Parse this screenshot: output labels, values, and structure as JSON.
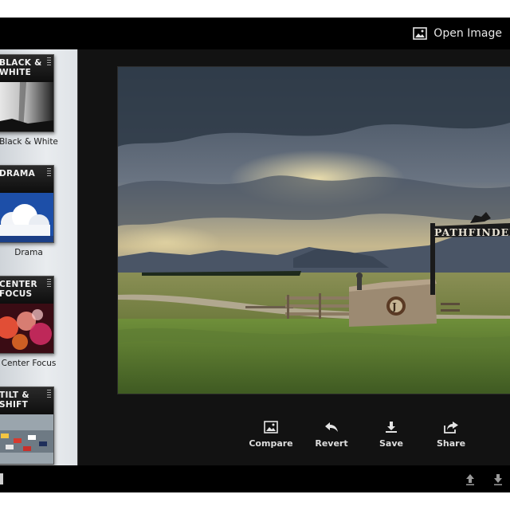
{
  "topbar": {
    "open_image_label": "Open Image"
  },
  "filters": [
    {
      "title": "BLACK & WHITE",
      "label": "Black & White"
    },
    {
      "title": "DRAMA",
      "label": "Drama"
    },
    {
      "title": "CENTER FOCUS",
      "label": "Center Focus"
    },
    {
      "title": "TILT & SHIFT",
      "label": ""
    }
  ],
  "photo": {
    "sign_text": "PATHFINDER"
  },
  "actions": {
    "compare": "Compare",
    "revert": "Revert",
    "save": "Save",
    "share": "Share"
  },
  "icons": {
    "open_image": "image-icon",
    "compare": "image-icon",
    "revert": "undo-arrow-icon",
    "save": "download-icon",
    "share": "share-icon",
    "up": "upload-arrow-icon",
    "down": "download-arrow-icon"
  },
  "colors": {
    "background": "#0a0a0a",
    "sidebar": "#e3e6e9",
    "text": "#e4e4e4"
  }
}
